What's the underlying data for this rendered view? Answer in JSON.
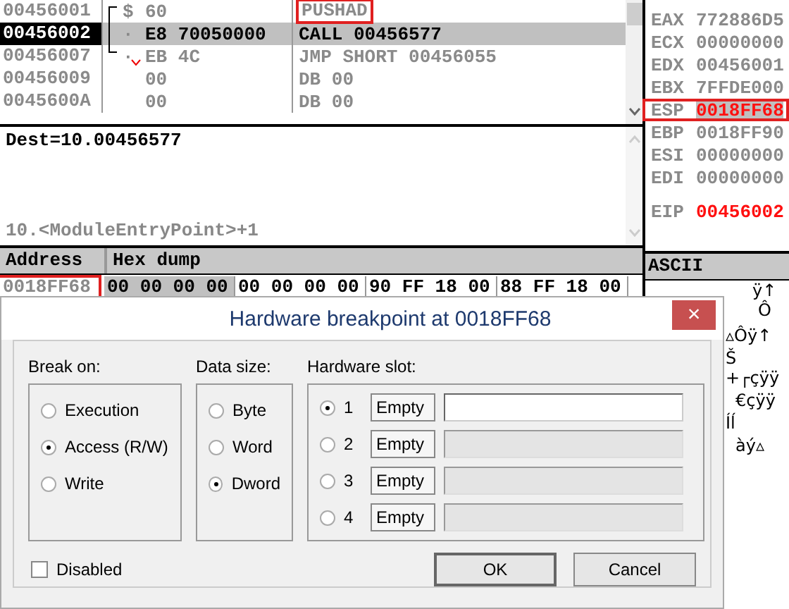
{
  "disassembly": {
    "rows": [
      {
        "address": "00456001",
        "marker": "$",
        "bytes": "60",
        "instruction": "PUSHAD",
        "selected": false,
        "outlined": true,
        "jump": false
      },
      {
        "address": "00456002",
        "marker": "·",
        "bytes": "E8 70050000",
        "instruction": "CALL 00456577",
        "selected": true,
        "outlined": false,
        "jump": false
      },
      {
        "address": "00456007",
        "marker": "·",
        "bytes": "EB 4C",
        "instruction": "JMP SHORT 00456055",
        "selected": false,
        "outlined": false,
        "jump": true
      },
      {
        "address": "00456009",
        "marker": "",
        "bytes": "00",
        "instruction": "DB 00",
        "selected": false,
        "outlined": false,
        "jump": false
      },
      {
        "address": "0045600A",
        "marker": "",
        "bytes": "00",
        "instruction": "DB 00",
        "selected": false,
        "outlined": false,
        "jump": false
      }
    ]
  },
  "registers": [
    {
      "name": "EAX",
      "value": "772886D5",
      "changed": false,
      "outlined": false
    },
    {
      "name": "ECX",
      "value": "00000000",
      "changed": false,
      "outlined": false
    },
    {
      "name": "EDX",
      "value": "00456001",
      "changed": false,
      "outlined": false
    },
    {
      "name": "EBX",
      "value": "7FFDE000",
      "changed": false,
      "outlined": false
    },
    {
      "name": "ESP",
      "value": "0018FF68",
      "changed": true,
      "outlined": true
    },
    {
      "name": "EBP",
      "value": "0018FF90",
      "changed": false,
      "outlined": false
    },
    {
      "name": "ESI",
      "value": "00000000",
      "changed": false,
      "outlined": false
    },
    {
      "name": "EDI",
      "value": "00000000",
      "changed": false,
      "outlined": false
    }
  ],
  "eip": {
    "name": "EIP",
    "value": "00456002",
    "changed": true
  },
  "info": {
    "line_1": "Dest=10.00456577",
    "line_2": "10.<ModuleEntryPoint>+1"
  },
  "dump": {
    "columns": [
      "Address",
      "Hex dump"
    ],
    "ascii_column": "ASCII",
    "row": {
      "address": "0018FF68",
      "outlined": true,
      "groups": [
        {
          "text": "00 00 00 00",
          "selected": true
        },
        {
          "text": "00 00 00 00",
          "selected": false
        },
        {
          "text": "90 FF 18 00",
          "selected": false
        },
        {
          "text": "88 FF 18 00",
          "selected": false
        }
      ]
    },
    "ascii_lines": [
      "ÿ↑",
      "Ô",
      "▵Ôÿ↑",
      "Š",
      "+┌çÿÿ",
      "€çÿÿ",
      "Íĺ",
      "àý▵"
    ]
  },
  "dialog": {
    "title": "Hardware breakpoint at 0018FF68",
    "close": "×",
    "break_on": {
      "label": "Break on:",
      "options": [
        {
          "label": "Execution",
          "selected": false
        },
        {
          "label": "Access (R/W)",
          "selected": true
        },
        {
          "label": "Write",
          "selected": false
        }
      ]
    },
    "data_size": {
      "label": "Data size:",
      "options": [
        {
          "label": "Byte",
          "selected": false
        },
        {
          "label": "Word",
          "selected": false
        },
        {
          "label": "Dword",
          "selected": true
        }
      ]
    },
    "slots": {
      "label": "Hardware slot:",
      "items": [
        {
          "number": "1",
          "status": "Empty",
          "selected": true,
          "enabled": true
        },
        {
          "number": "2",
          "status": "Empty",
          "selected": false,
          "enabled": false
        },
        {
          "number": "3",
          "status": "Empty",
          "selected": false,
          "enabled": false
        },
        {
          "number": "4",
          "status": "Empty",
          "selected": false,
          "enabled": false
        }
      ]
    },
    "disabled": {
      "label": "Disabled",
      "checked": false
    },
    "buttons": [
      "OK",
      "Cancel"
    ]
  }
}
